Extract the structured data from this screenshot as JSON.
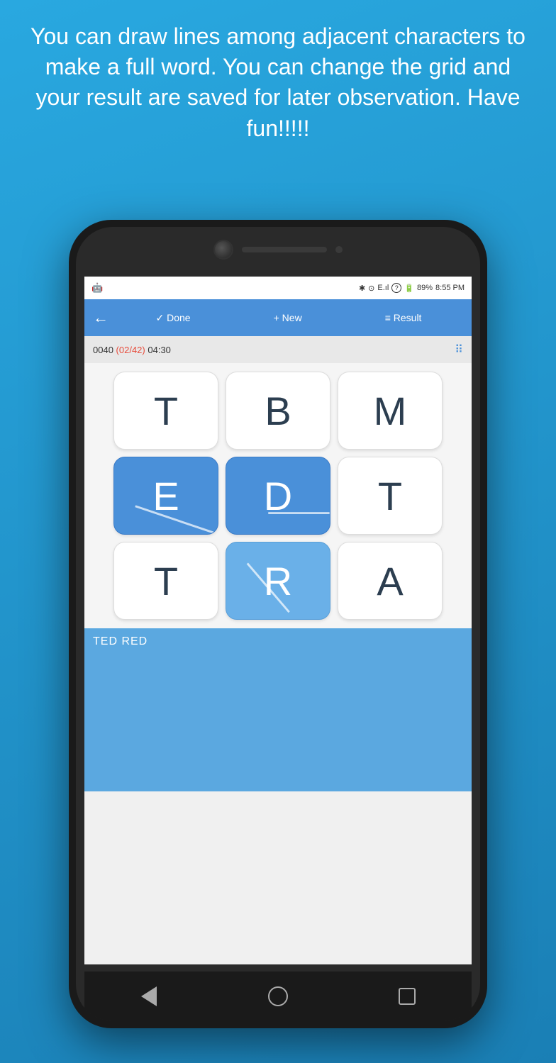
{
  "header": {
    "text": "You can draw lines among adjacent characters to make a full word. You can change the grid and your result are saved for later observation. Have fun!!!!!"
  },
  "status_bar": {
    "left_icon": "android-icon",
    "bluetooth": "✱",
    "alarm": "⏰",
    "signal": "E.ıl",
    "question": "?",
    "battery": "89%",
    "time": "8:55 PM"
  },
  "app_bar": {
    "back_label": "←",
    "done_label": "✓ Done",
    "new_label": "+ New",
    "result_label": "≡ Result"
  },
  "info_bar": {
    "puzzle_id": "0040",
    "count_label": "(02/42)",
    "timer": "04:30"
  },
  "grid": {
    "rows": [
      [
        {
          "letter": "T",
          "selected": false
        },
        {
          "letter": "B",
          "selected": false
        },
        {
          "letter": "M",
          "selected": false
        }
      ],
      [
        {
          "letter": "E",
          "selected": true,
          "has_line": true
        },
        {
          "letter": "D",
          "selected": true,
          "has_line": true
        },
        {
          "letter": "T",
          "selected": false
        }
      ],
      [
        {
          "letter": "T",
          "selected": false
        },
        {
          "letter": "R",
          "selected": true,
          "partial": true
        },
        {
          "letter": "A",
          "selected": false
        }
      ]
    ]
  },
  "words": {
    "found": "TED   RED"
  },
  "nav": {
    "back": "back",
    "home": "home",
    "recent": "recent"
  }
}
